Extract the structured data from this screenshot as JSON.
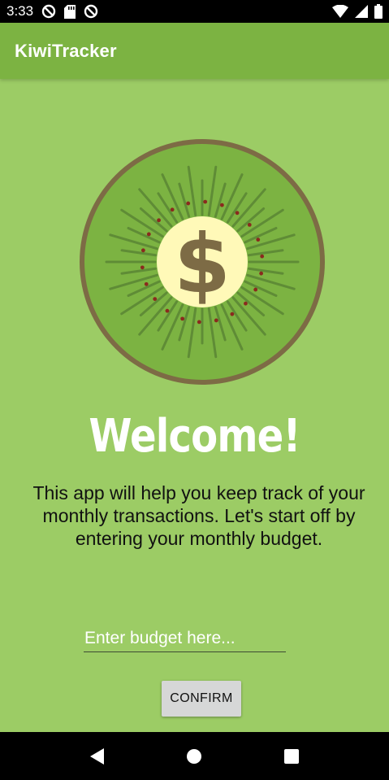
{
  "status_bar": {
    "time": "3:33",
    "icons": [
      "sync-icon",
      "sd-card-icon",
      "sync-icon",
      "wifi-icon",
      "cellular-signal-icon",
      "battery-icon"
    ]
  },
  "app_bar": {
    "title": "KiwiTracker"
  },
  "logo": {
    "icon": "kiwi-dollar-logo",
    "symbol": "$"
  },
  "main": {
    "welcome": "Welcome!",
    "description": "This app will help you keep track of your monthly transactions. Let's start off by entering your monthly budget."
  },
  "budget_input": {
    "placeholder": "Enter budget here...",
    "value": ""
  },
  "confirm_button": {
    "label": "CONFIRM"
  },
  "nav_bar": {
    "icons": [
      "back-icon",
      "home-icon",
      "recents-icon"
    ]
  },
  "colors": {
    "app_bar": "#7cb342",
    "background": "#9ccc65",
    "kiwi_flesh": "#7cb342",
    "kiwi_skin": "#7d6b45",
    "kiwi_core": "#fff9b8",
    "button": "#d6d7d7"
  }
}
